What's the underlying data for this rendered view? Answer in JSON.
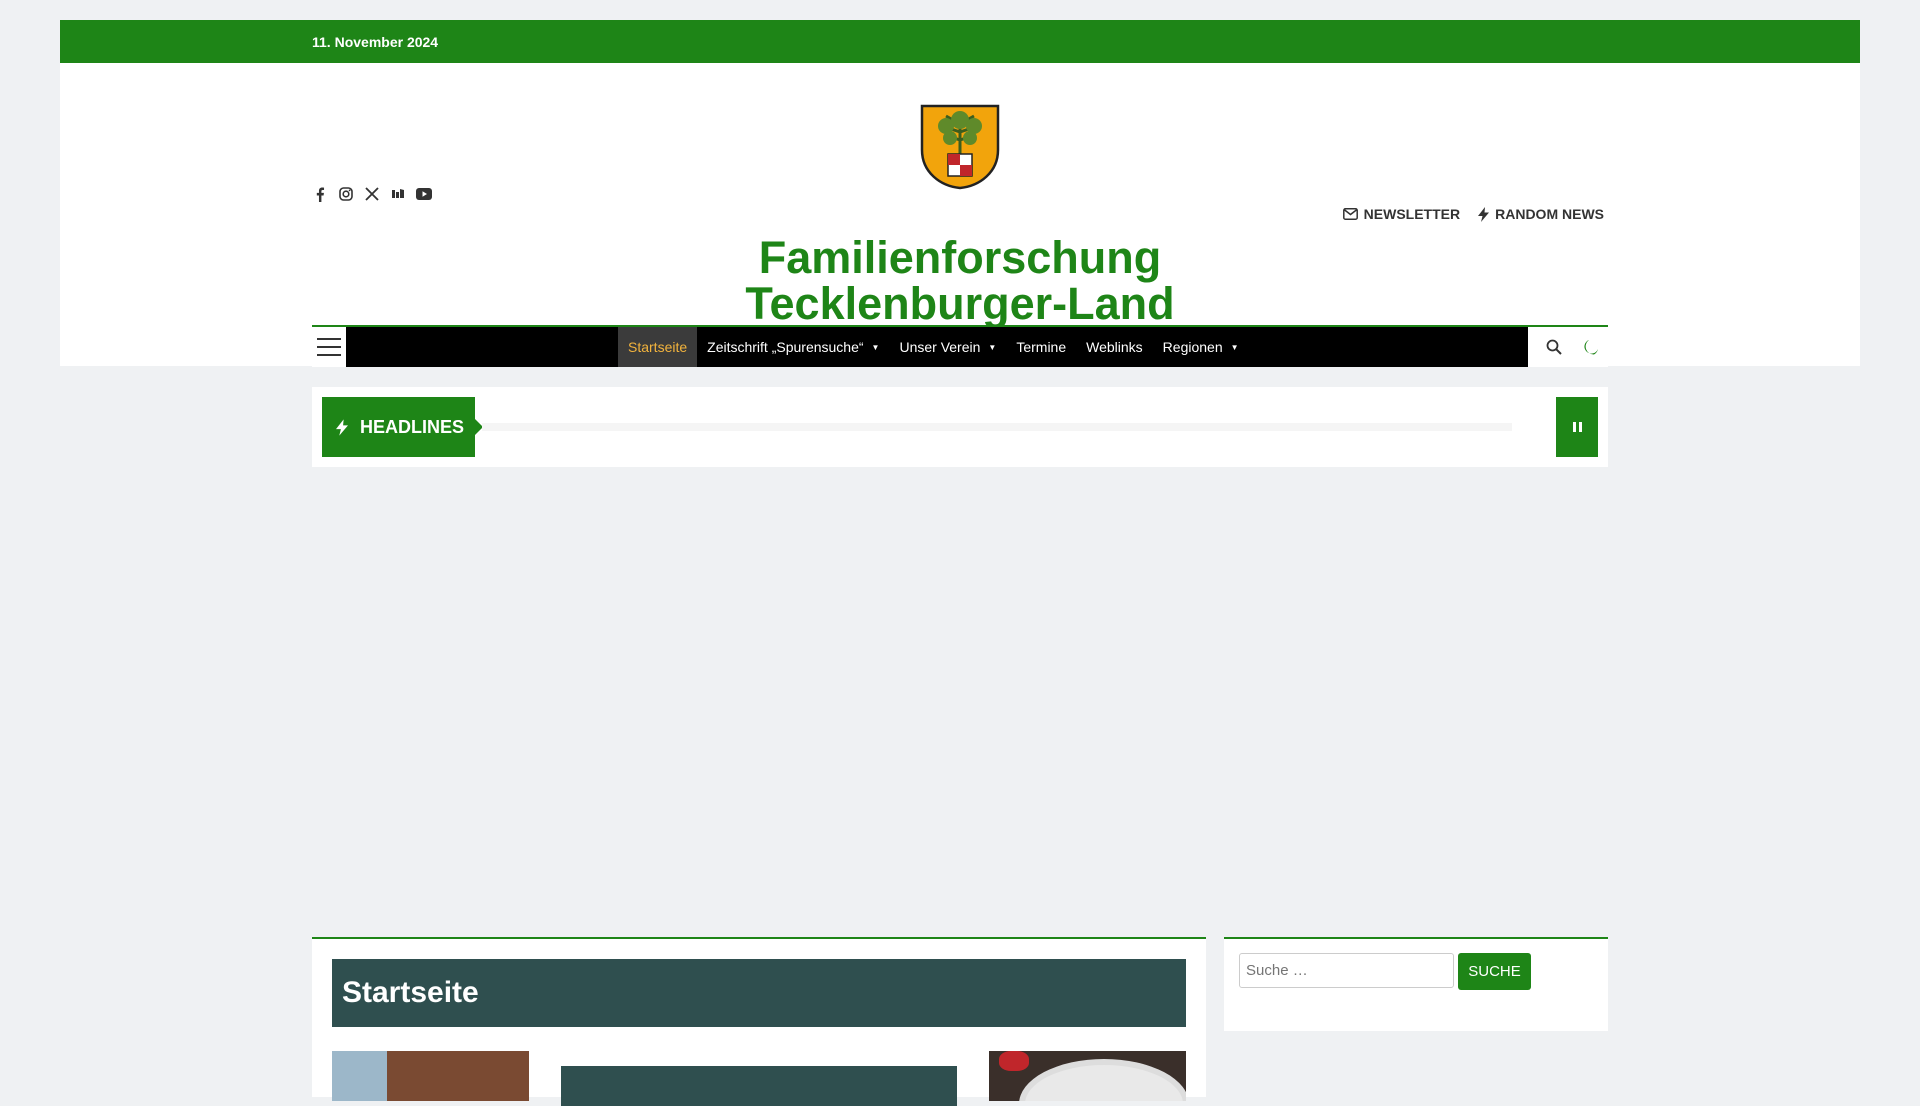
{
  "topbar": {
    "date": "11. November 2024"
  },
  "header": {
    "title_line1": "Familienforschung",
    "title_line2": "Tecklenburger-Land",
    "links": [
      {
        "label": "NEWSLETTER",
        "icon": "envelope-icon"
      },
      {
        "label": "RANDOM NEWS",
        "icon": "bolt-icon"
      }
    ],
    "social": [
      "facebook-icon",
      "instagram-icon",
      "x-twitter-icon",
      "vk-icon",
      "youtube-icon"
    ]
  },
  "nav": {
    "items": [
      {
        "label": "Startseite",
        "active": true
      },
      {
        "label": "Zeitschrift „Spurensuche“",
        "dropdown": true
      },
      {
        "label": "Unser Verein",
        "dropdown": true
      },
      {
        "label": "Termine"
      },
      {
        "label": "Weblinks"
      },
      {
        "label": "Regionen",
        "dropdown": true
      }
    ]
  },
  "headlines": {
    "label": "HEADLINES"
  },
  "main": {
    "page_title": "Startseite"
  },
  "sidebar": {
    "search_placeholder": "Suche …",
    "search_button": "SUCHE"
  },
  "colors": {
    "brand": "#1e8517",
    "title_bar": "#2f4f4f",
    "active_menu_text": "#f2b33d"
  }
}
